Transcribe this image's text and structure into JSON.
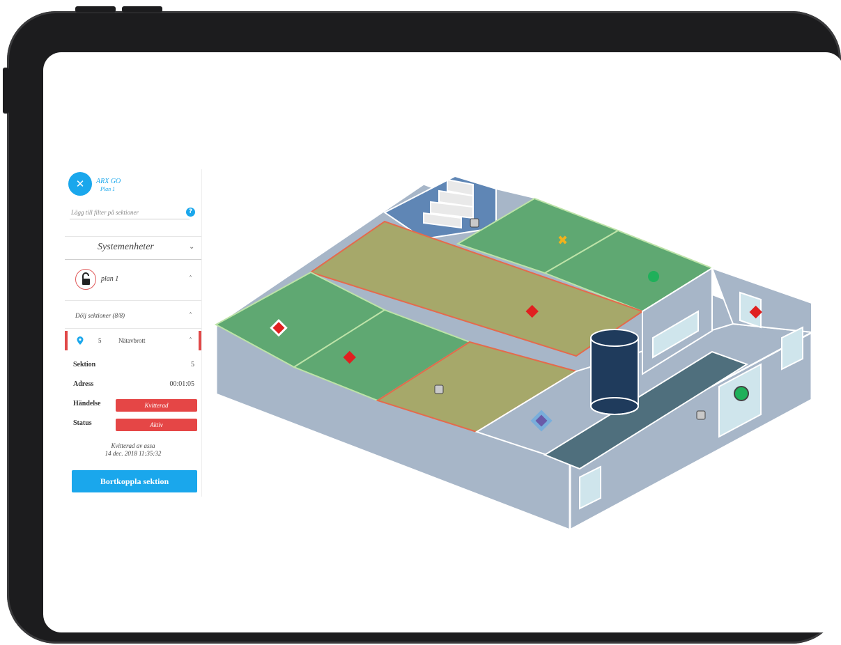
{
  "app": {
    "title": "ARX GO",
    "subtitle": "Plan 1",
    "close_glyph": "✕"
  },
  "filter": {
    "placeholder": "Lägg till filter på sektioner",
    "value": "",
    "help_glyph": "?"
  },
  "system_units": {
    "label": "Systemenheter",
    "chevron": "⌄"
  },
  "plan": {
    "label": "plan 1",
    "chevron": "˄",
    "icon": "unlocked-padlock-icon"
  },
  "sections_toggle": {
    "label": "Dölj sektioner (8/8)",
    "chevron": "˄"
  },
  "alarm_item": {
    "number": "5",
    "event": "Nätavbrott",
    "chevron": "˄",
    "icon": "location-pin-icon"
  },
  "details": {
    "section_label": "Sektion",
    "section_value": "5",
    "address_label": "Adress",
    "address_value": "00:01:05",
    "event_label": "Händelse",
    "event_value": "Kvitterad",
    "status_label": "Status",
    "status_value": "Aktiv"
  },
  "acknowledged": {
    "text": "Kvitterad av assa",
    "time": "14 dec. 2018 11:35:32"
  },
  "disconnect_button": {
    "label": "Bortkoppla sektion"
  },
  "colors": {
    "accent": "#1aa7ec",
    "alarm": "#e54646",
    "room_green": "#5fa872",
    "room_olive": "#a6a86a",
    "wall": "#a7b6c8",
    "stair_room": "#5f86b5",
    "device_frame": "#1c1c1e"
  },
  "map_markers": [
    {
      "type": "alarm-diamond",
      "room": "left-green-room",
      "state": "alarm"
    },
    {
      "type": "alarm-diamond",
      "room": "center-green-room",
      "state": "alarm"
    },
    {
      "type": "alarm-diamond",
      "room": "long-olive-corridor",
      "state": "alarm"
    },
    {
      "type": "alarm-diamond",
      "room": "right-window-room",
      "state": "alarm"
    },
    {
      "type": "fault-cross",
      "room": "top-green-room",
      "state": "warning"
    },
    {
      "type": "ok-circle",
      "room": "top-right-green-room",
      "state": "ok"
    },
    {
      "type": "ok-circle",
      "room": "entrance-door",
      "state": "ok"
    },
    {
      "type": "inactive-square",
      "room": "stair-room",
      "state": "inactive"
    },
    {
      "type": "inactive-square",
      "room": "lower-olive-room",
      "state": "inactive"
    },
    {
      "type": "inactive-square",
      "room": "hallway",
      "state": "inactive"
    },
    {
      "type": "selected-diamond",
      "room": "hallway",
      "state": "selected"
    }
  ]
}
